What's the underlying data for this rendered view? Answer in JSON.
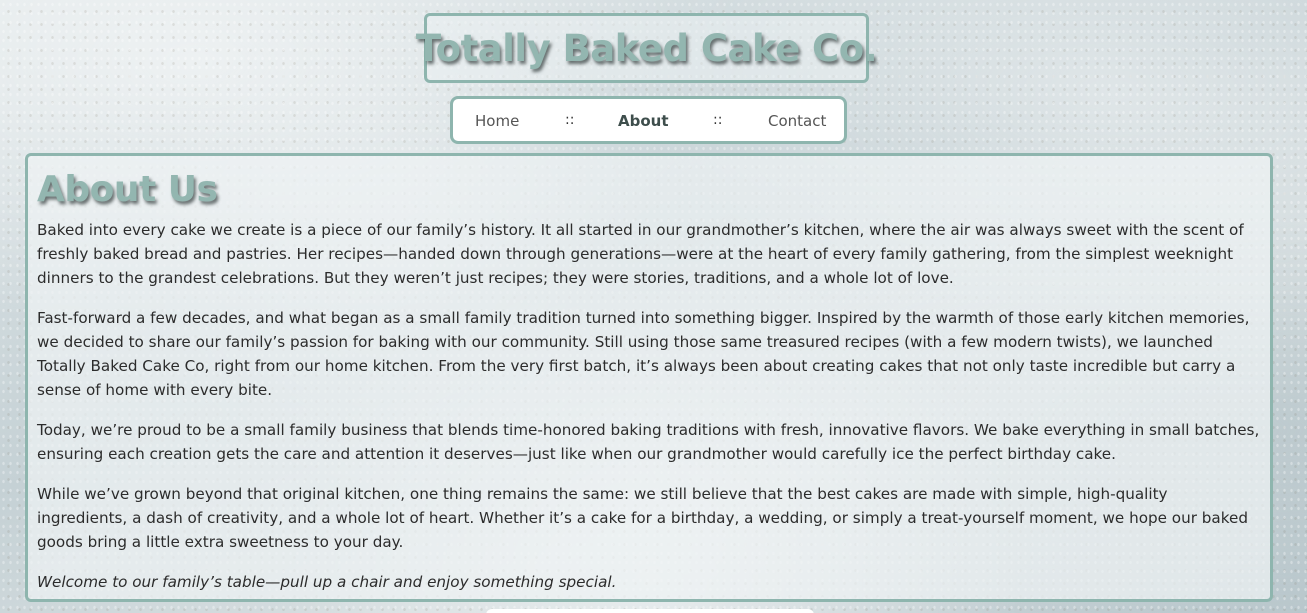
{
  "header": {
    "site_title": "Totally Baked Cake Co."
  },
  "nav": {
    "home": "Home",
    "separator": "::",
    "about": "About",
    "contact": "Contact",
    "active": "About"
  },
  "main": {
    "heading": "About Us",
    "paragraphs": [
      "Baked into every cake we create is a piece of our family’s history. It all started in our grandmother’s kitchen, where the air was always sweet with the scent of freshly baked bread and pastries. Her recipes—handed down through generations—were at the heart of every family gathering, from the simplest weeknight dinners to the grandest celebrations. But they weren’t just recipes; they were stories, traditions, and a whole lot of love.",
      "Fast-forward a few decades, and what began as a small family tradition turned into something bigger. Inspired by the warmth of those early kitchen memories, we decided to share our family’s passion for baking with our community. Still using those same treasured recipes (with a few modern twists), we launched Totally Baked Cake Co, right from our home kitchen. From the very first batch, it’s always been about creating cakes that not only taste incredible but carry a sense of home with every bite.",
      "Today, we’re proud to be a small family business that blends time-honored baking traditions with fresh, innovative flavors. We bake everything in small batches, ensuring each creation gets the care and attention it deserves—just like when our grandmother would carefully ice the perfect birthday cake.",
      "While we’ve grown beyond that original kitchen, one thing remains the same: we still believe that the best cakes are made with simple, high-quality ingredients, a dash of creativity, and a whole lot of heart. Whether it’s a cake for a birthday, a wedding, or simply a treat-yourself moment, we hope our baked goods bring a little extra sweetness to your day."
    ],
    "closing": "Welcome to our family’s table—pull up a chair and enjoy something special."
  },
  "colors": {
    "accent": "#8eb5ae",
    "title_text": "#93b6b0",
    "body_text": "#2c2c2c"
  }
}
